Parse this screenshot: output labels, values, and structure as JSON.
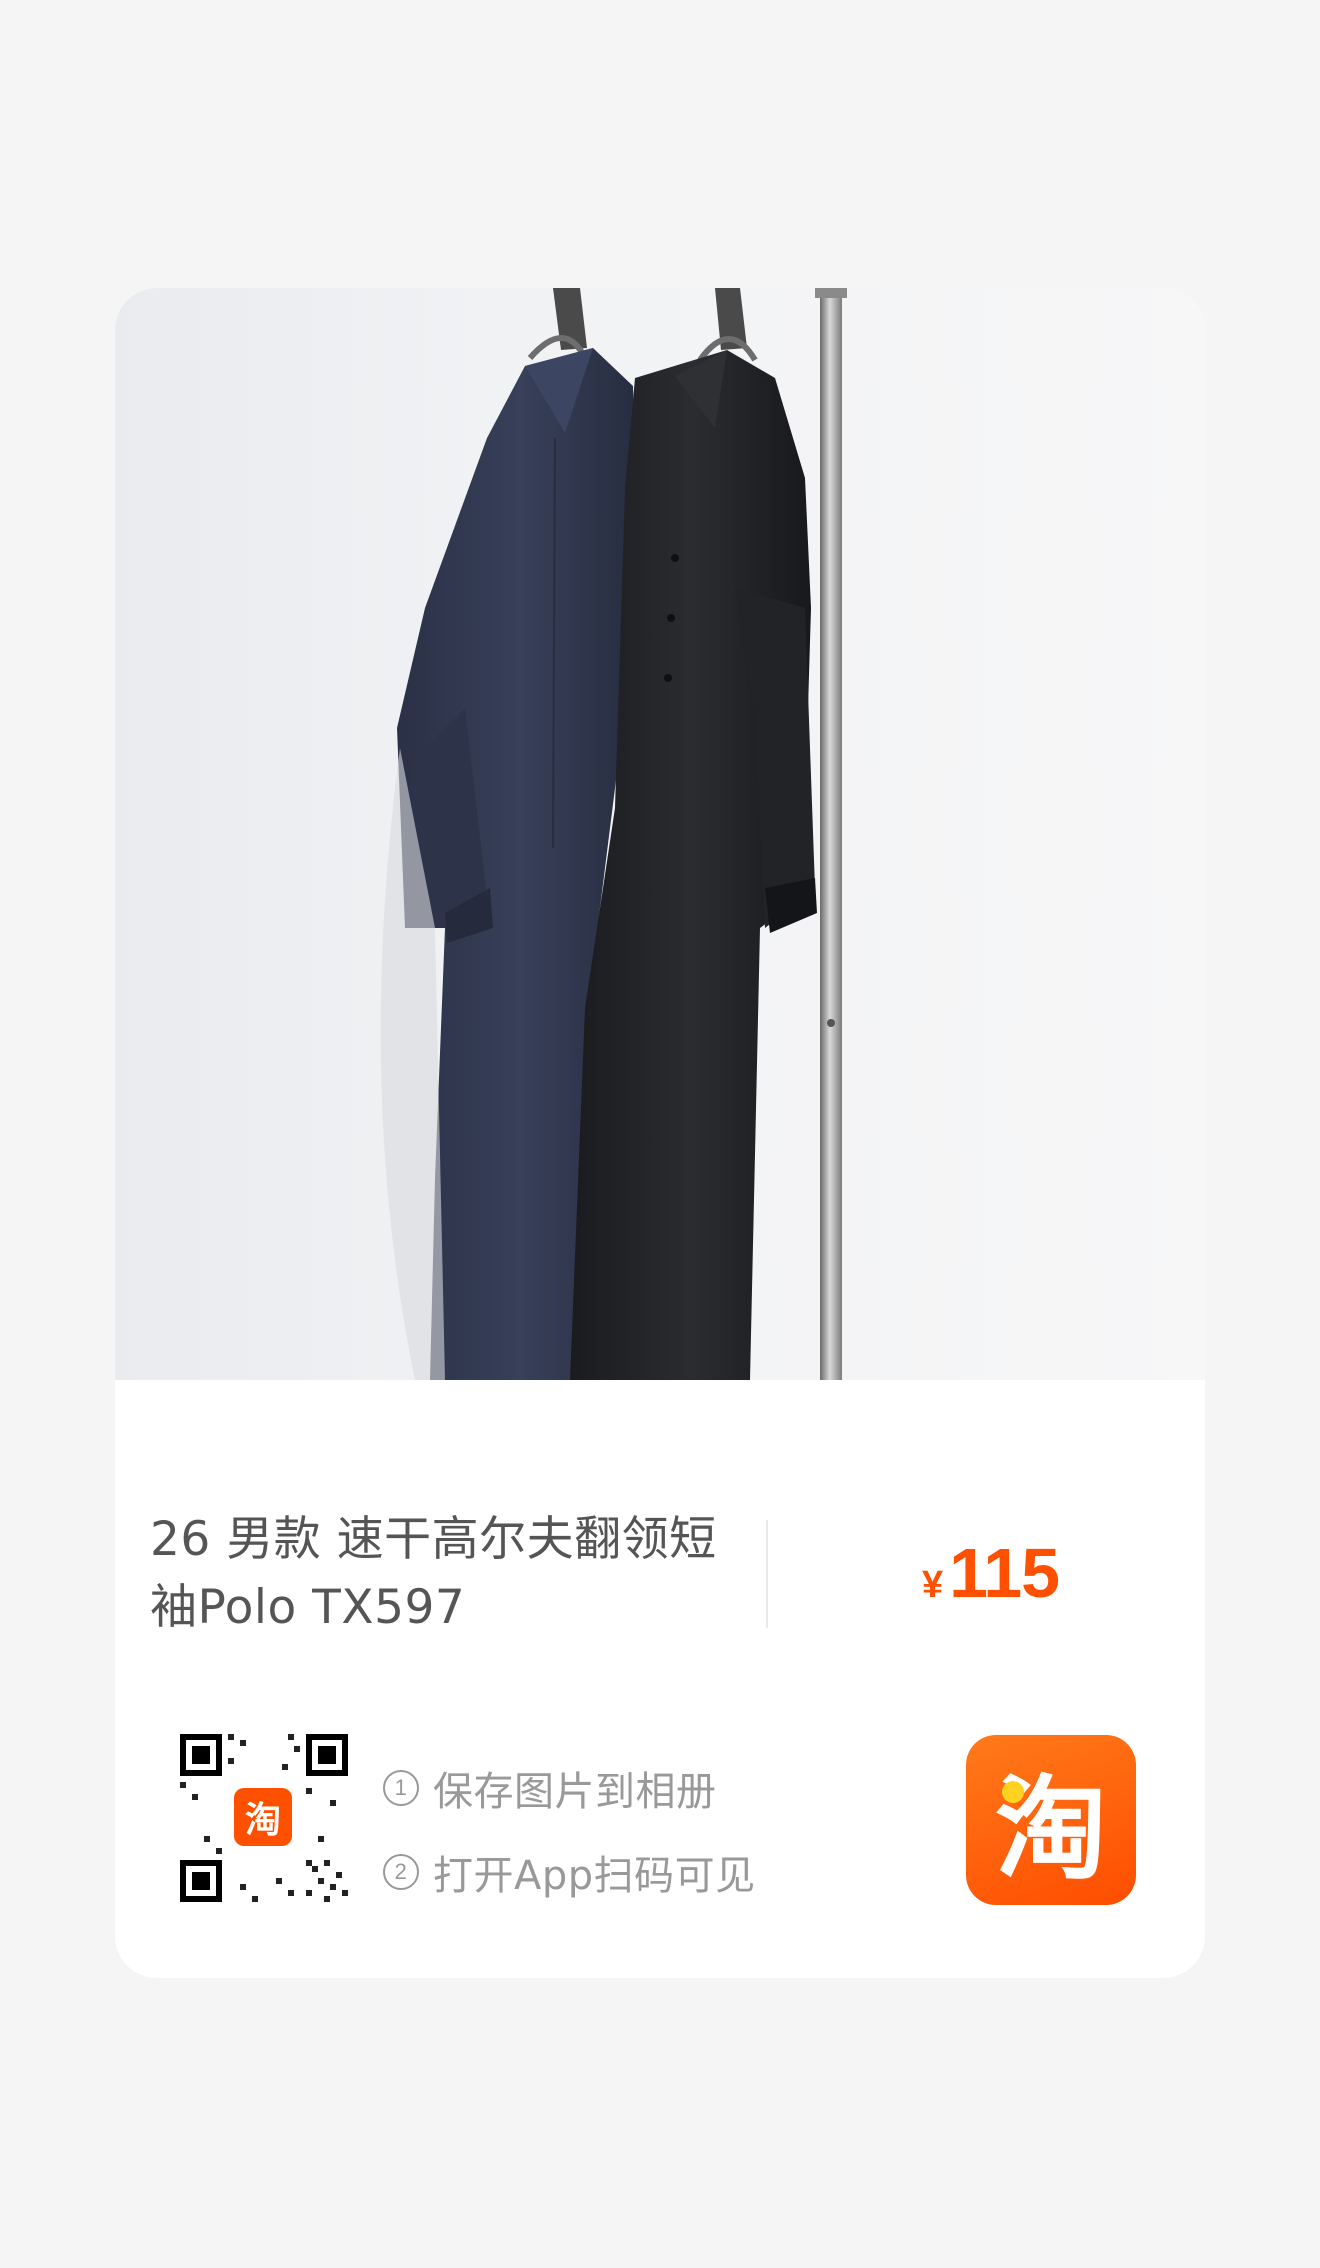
{
  "product": {
    "title": "26 男款 速干高尔夫翻领短\n袖Polo TX597",
    "price_currency": "¥",
    "price_value": "115"
  },
  "qr": {
    "logo_char": "淘"
  },
  "steps": [
    {
      "num": "1",
      "text": "保存图片到相册"
    },
    {
      "num": "2",
      "text": "打开App扫码可见"
    }
  ],
  "app_icon": {
    "char": "淘",
    "name": "taobao-app-icon"
  },
  "colors": {
    "accent": "#ff5000",
    "page_bg": "#f5f5f5",
    "card_bg": "#ffffff",
    "title_text": "#555555",
    "muted_text": "#999999"
  }
}
